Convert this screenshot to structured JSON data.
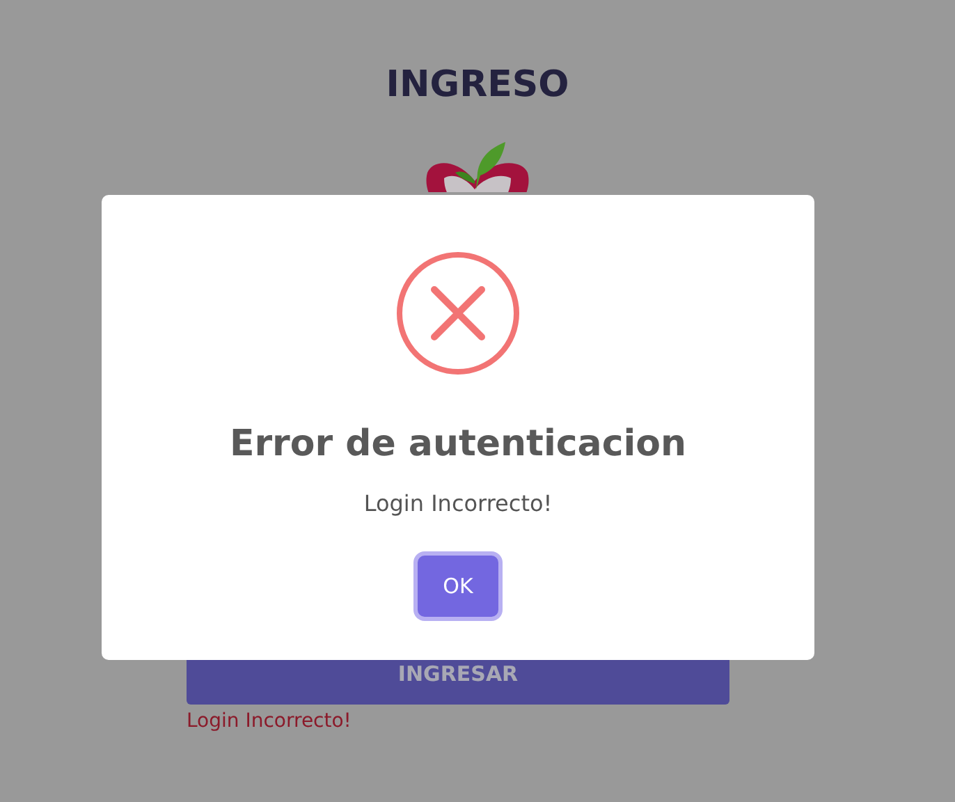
{
  "page": {
    "title": "INGRESO",
    "submit_button": "INGRESAR",
    "error_message": "Login Incorrecto!"
  },
  "dialog": {
    "title": "Error de autenticacion",
    "message": "Login Incorrecto!",
    "button": "OK"
  }
}
